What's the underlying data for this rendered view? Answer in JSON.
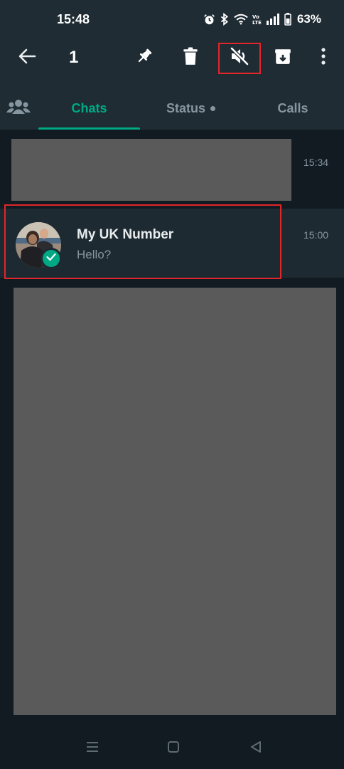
{
  "status_bar": {
    "time": "15:48",
    "battery": "63%",
    "icons": [
      "alarm-icon",
      "bluetooth-icon",
      "wifi-icon",
      "volte-icon",
      "signal-icon",
      "battery-icon"
    ]
  },
  "toolbar": {
    "selected_count": "1",
    "actions": [
      "back-arrow-icon",
      "pin-icon",
      "delete-icon",
      "mute-icon",
      "archive-icon",
      "more-options-icon"
    ]
  },
  "tabs": {
    "community_icon": "community-icon",
    "items": [
      {
        "label": "Chats",
        "active": true
      },
      {
        "label": "Status",
        "active": false,
        "has_update_dot": true
      },
      {
        "label": "Calls",
        "active": false
      }
    ]
  },
  "chats": {
    "rows": [
      {
        "time": "15:34",
        "redacted": true
      },
      {
        "name": "My UK Number",
        "preview": "Hello?",
        "time": "15:00",
        "selected": true
      }
    ]
  },
  "colors": {
    "header_bg": "#1f2c34",
    "background": "#111b21",
    "accent": "#00a884",
    "highlight_box": "#e1262a",
    "redaction": "#5a5a5a"
  }
}
